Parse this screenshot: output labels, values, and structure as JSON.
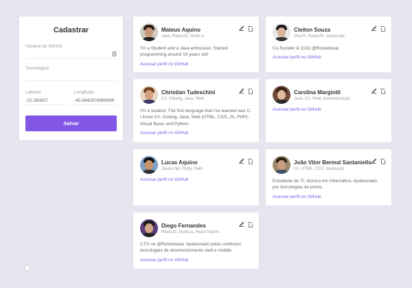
{
  "sidebar": {
    "title": "Cadastrar",
    "github_user_label": "Usuário do GitHub",
    "github_user_value": "",
    "techs_label": "Tecnologias",
    "techs_value": "",
    "latitude_label": "Latitude",
    "latitude_value": "-23.260657",
    "longitude_label": "Longitude",
    "longitude_value": "-45.8942678999999",
    "save_label": "Salvar"
  },
  "link_label": "Acessar perfil no GitHub",
  "devs": [
    {
      "name": "Mateus Aquino",
      "techs": "Java, ReactJS, Node.js",
      "bio": "I'm a Student and a Java enthusiast. Started programming around 10 years old!",
      "colors": {
        "bg": "#cfc9c2",
        "hair": "#2b1d16",
        "face": "#c99a7c",
        "body": "#222"
      }
    },
    {
      "name": "Cleiton Souza",
      "techs": "VueJS, ReactJS, Javascript",
      "bio": "Co-founder & COO @Rocketseat",
      "colors": {
        "bg": "#e8e8e8",
        "hair": "#1a1a1a",
        "face": "#d8b39b",
        "body": "#333"
      }
    },
    {
      "name": "Christian Tudeschini",
      "techs": "C#, Golang, Java, Web",
      "bio": "I'm a student, The first language that I've learned was C. I know C#, Golang, Java, Web (HTML, CSS, JS, PHP), Visual Basic and Python.",
      "colors": {
        "bg": "#e7d7c2",
        "hair": "#6b3f1f",
        "face": "#d4a07c",
        "body": "#3b3b6b"
      }
    },
    {
      "name": "Carolina Margiotti",
      "techs": "Java, C#, Web, Automatização",
      "bio": "",
      "colors": {
        "bg": "#6e4a3a",
        "hair": "#3a2114",
        "face": "#e2b99d",
        "body": "#2a2a2a"
      }
    },
    {
      "name": "Lucas Aquino",
      "techs": "Javascript, Ruby, Rails",
      "bio": "",
      "colors": {
        "bg": "#7da1c7",
        "hair": "#111",
        "face": "#c8946c",
        "body": "#333"
      }
    },
    {
      "name": "João Vitor Bermal Santaniello",
      "techs": "C#, HTML, CSS, Javascript",
      "bio": "Estudante de TI, técnico em informática. Apaixonado por tecnologias de ponta.",
      "colors": {
        "bg": "#9a8a6e",
        "hair": "#2e2214",
        "face": "#caa080",
        "body": "#44506a"
      }
    },
    {
      "name": "Diego Fernandes",
      "techs": "ReactJS, Node.js, React Native",
      "bio": "CTO na @Rocketseat. Apaixonado pelas melhores tecnologias de desenvolvimento web e mobile.",
      "colors": {
        "bg": "#5b3b7a",
        "hair": "#1b1b1b",
        "face": "#d1a688",
        "body": "#222"
      }
    }
  ]
}
